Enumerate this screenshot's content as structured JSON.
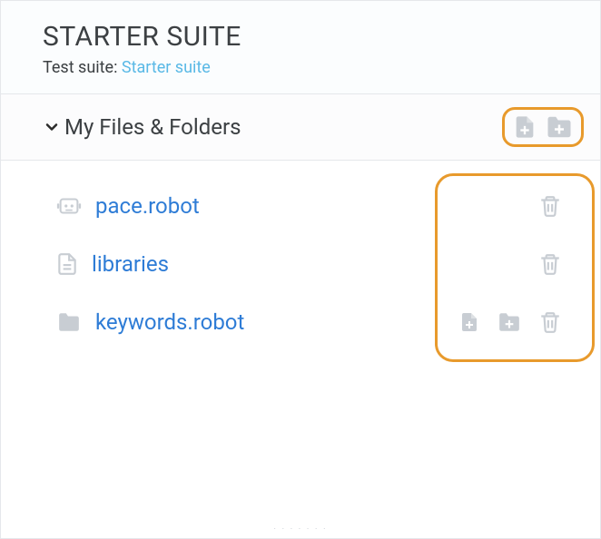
{
  "header": {
    "title": "STARTER SUITE",
    "sub_label": "Test suite: ",
    "sub_link": "Starter suite"
  },
  "section": {
    "title": "My Files & Folders"
  },
  "files": [
    {
      "name": "pace.robot",
      "icon": "robot"
    },
    {
      "name": "libraries",
      "icon": "file"
    },
    {
      "name": "keywords.robot",
      "icon": "folder"
    }
  ],
  "icons": {
    "add_file": "add-file-icon",
    "add_folder": "add-folder-icon",
    "trash": "trash-icon",
    "chevron_down": "chevron-down-icon",
    "robot": "robot-icon",
    "file": "file-icon",
    "folder": "folder-icon"
  },
  "colors": {
    "highlight": "#e89a2c",
    "link": "#2e7cd6",
    "sub_link": "#5ab9e6",
    "icon_gray": "#c8cdd3"
  }
}
